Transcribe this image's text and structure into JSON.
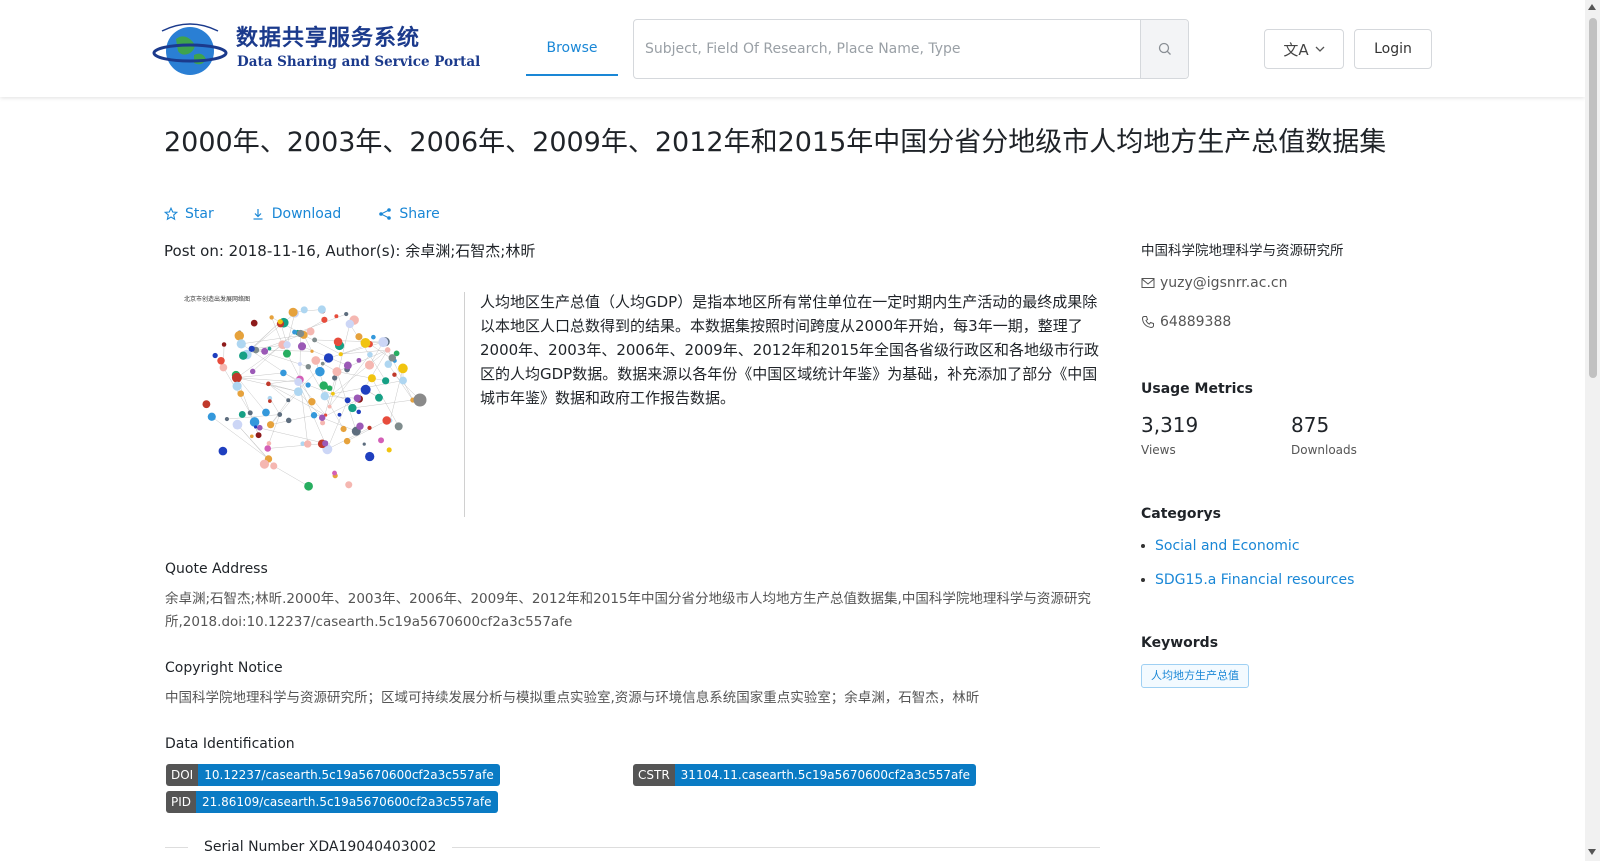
{
  "header": {
    "logo_cn": "数据共享服务系统",
    "logo_en": "Data Sharing and Service Portal",
    "nav_browse": "Browse",
    "search_placeholder": "Subject, Field Of Research, Place Name, Type",
    "login": "Login"
  },
  "dataset": {
    "title": "2000年、2003年、2006年、2009年、2012年和2015年中国分省分地级市人均地方生产总值数据集",
    "actions": {
      "star": "Star",
      "download": "Download",
      "share": "Share"
    },
    "post_line": "Post on: 2018-11-16, Author(s): 余卓渊;石智杰;林昕",
    "figure_caption": "北京市创造出发展网络图",
    "description": "人均地区生产总值（人均GDP）是指本地区所有常住单位在一定时期内生产活动的最终成果除以本地区人口总数得到的结果。本数据集按照时间跨度从2000年开始，每3年一期，整理了2000年、2003年、2006年、2009年、2012年和2015年全国各省级行政区和各地级市行政区的人均GDP数据。数据来源以各年份《中国区域统计年鉴》为基础，补充添加了部分《中国城市年鉴》数据和政府工作报告数据。"
  },
  "quote": {
    "title": "Quote Address",
    "text": "余卓渊;石智杰;林昕.2000年、2003年、2006年、2009年、2012年和2015年中国分省分地级市人均地方生产总值数据集,中国科学院地理科学与资源研究所,2018.doi:10.12237/casearth.5c19a5670600cf2a3c557afe"
  },
  "copyright": {
    "title": "Copyright Notice",
    "text": "中国科学院地理科学与资源研究所；区域可持续发展分析与模拟重点实验室,资源与环境信息系统国家重点实验室；余卓渊，石智杰，林昕"
  },
  "identification": {
    "title": "Data Identification",
    "doi_key": "DOI",
    "doi_value": "10.12237/casearth.5c19a5670600cf2a3c557afe",
    "cstr_key": "CSTR",
    "cstr_value": "31104.11.casearth.5c19a5670600cf2a3c557afe",
    "pid_key": "PID",
    "pid_value": "21.86109/casearth.5c19a5670600cf2a3c557afe"
  },
  "serial": "Serial Number XDA19040403002",
  "sidebar": {
    "org": "中国科学院地理科学与资源研究所",
    "email": "yuzy@igsnrr.ac.cn",
    "phone": "64889388",
    "usage_title": "Usage Metrics",
    "views_value": "3,319",
    "views_label": "Views",
    "downloads_value": "875",
    "downloads_label": "Downloads",
    "categories_title": "Categorys",
    "categories": [
      "Social and Economic",
      "SDG15.a Financial resources"
    ],
    "keywords_title": "Keywords",
    "keywords": [
      "人均地方生产总值"
    ]
  },
  "colors": {
    "accent": "#1a87d6",
    "badge_key": "#555555",
    "badge_value": "#0a7bc4",
    "logo": "#1b3a8c"
  },
  "icons": [
    "globe-logo-icon",
    "search-icon",
    "translate-icon",
    "chevron-down-icon",
    "star-icon",
    "download-icon",
    "share-icon",
    "mail-icon",
    "phone-icon"
  ]
}
